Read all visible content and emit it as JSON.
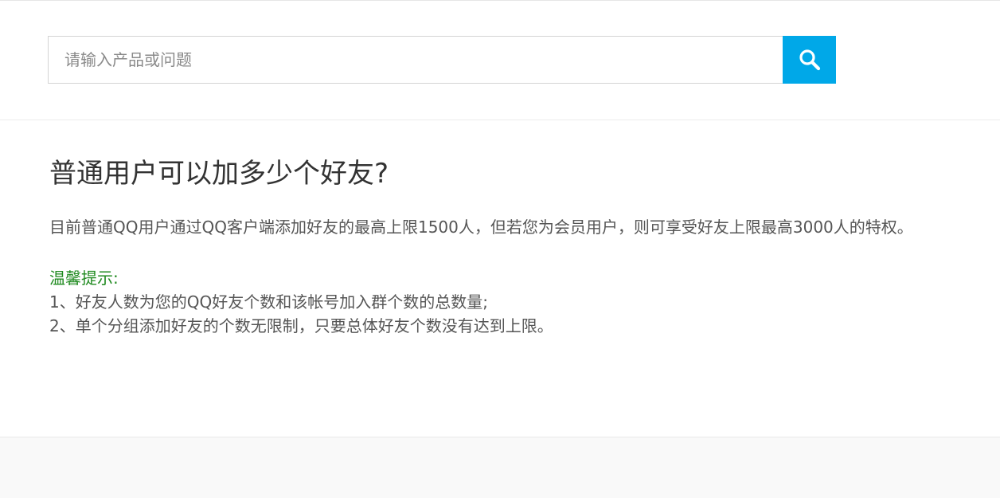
{
  "search": {
    "placeholder": "请输入产品或问题",
    "value": "",
    "button_icon": "search-icon",
    "button_color": "#00a8e8"
  },
  "article": {
    "title": "普通用户可以加多少个好友?",
    "answer": "目前普通QQ用户通过QQ客户端添加好友的最高上限1500人，但若您为会员用户，则可享受好友上限最高3000人的特权。",
    "tips": {
      "heading": "温馨提示:",
      "heading_color": "#1f8a1f",
      "items": [
        "1、好友人数为您的QQ好友个数和该帐号加入群个数的总数量;",
        "2、单个分组添加好友的个数无限制，只要总体好友个数没有达到上限。"
      ]
    }
  }
}
